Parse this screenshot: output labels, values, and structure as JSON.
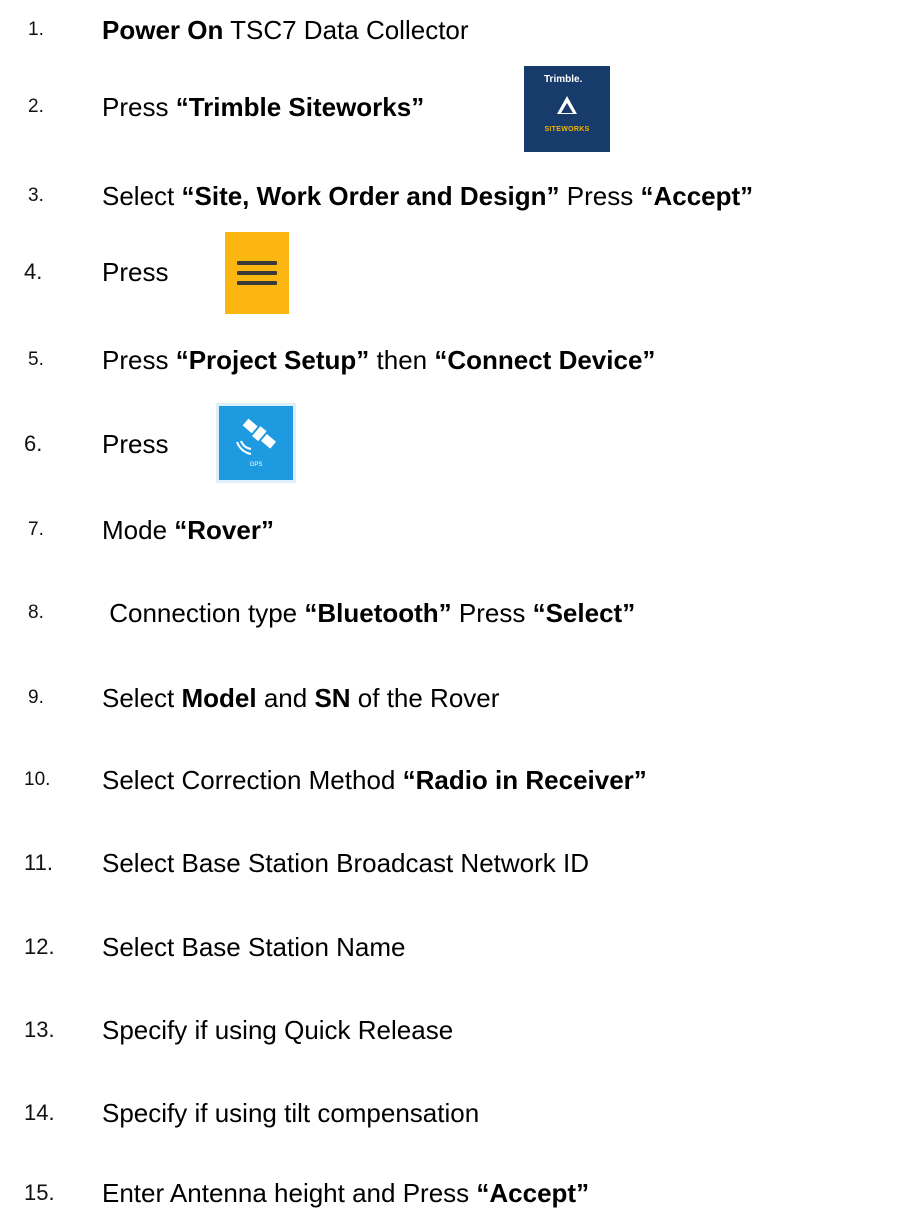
{
  "steps": [
    {
      "num": "1.",
      "parts": [
        {
          "t": "Power On",
          "b": true
        },
        {
          "t": " TSC7 Data Collector",
          "b": false
        }
      ]
    },
    {
      "num": "2.",
      "parts": [
        {
          "t": "Press ",
          "b": false
        },
        {
          "t": "“Trimble Siteworks”",
          "b": true
        }
      ]
    },
    {
      "num": "3.",
      "parts": [
        {
          "t": "Select ",
          "b": false
        },
        {
          "t": "“Site, Work Order and Design”",
          "b": true
        },
        {
          "t": " Press ",
          "b": false
        },
        {
          "t": "“Accept”",
          "b": true
        }
      ]
    },
    {
      "num": "4.",
      "parts": [
        {
          "t": "Press",
          "b": false
        }
      ]
    },
    {
      "num": "5.",
      "parts": [
        {
          "t": "Press ",
          "b": false
        },
        {
          "t": "“Project Setup”",
          "b": true
        },
        {
          "t": " then ",
          "b": false
        },
        {
          "t": "“Connect Device”",
          "b": true
        }
      ]
    },
    {
      "num": "6.",
      "parts": [
        {
          "t": "Press",
          "b": false
        }
      ]
    },
    {
      "num": "7.",
      "parts": [
        {
          "t": "Mode ",
          "b": false
        },
        {
          "t": "“Rover”",
          "b": true
        }
      ]
    },
    {
      "num": "8.",
      "parts": [
        {
          "t": " Connection type ",
          "b": false
        },
        {
          "t": "“Bluetooth”",
          "b": true
        },
        {
          "t": " Press ",
          "b": false
        },
        {
          "t": "“Select”",
          "b": true
        }
      ]
    },
    {
      "num": "9.",
      "parts": [
        {
          "t": "Select ",
          "b": false
        },
        {
          "t": "Model",
          "b": true
        },
        {
          "t": " and ",
          "b": false
        },
        {
          "t": "SN",
          "b": true
        },
        {
          "t": " of the Rover",
          "b": false
        }
      ]
    },
    {
      "num": "10.",
      "parts": [
        {
          "t": "Select Correction Method ",
          "b": false
        },
        {
          "t": "“Radio in Receiver”",
          "b": true
        }
      ]
    },
    {
      "num": "11.",
      "parts": [
        {
          "t": "Select Base Station Broadcast Network ID",
          "b": false
        }
      ]
    },
    {
      "num": "12.",
      "parts": [
        {
          "t": "Select Base Station Name",
          "b": false
        }
      ]
    },
    {
      "num": "13.",
      "parts": [
        {
          "t": "Specify if using Quick Release",
          "b": false
        }
      ]
    },
    {
      "num": "14.",
      "parts": [
        {
          "t": "Specify if using tilt compensation",
          "b": false
        }
      ]
    },
    {
      "num": "15.",
      "parts": [
        {
          "t": "Enter Antenna height and Press ",
          "b": false
        },
        {
          "t": "“Accept”",
          "b": true
        }
      ]
    }
  ],
  "icons": {
    "trimble_siteworks": {
      "name": "trimble-siteworks-app-icon",
      "brand": "Trimble.",
      "caption": "SITEWORKS",
      "bg": "#173b6a",
      "accent": "#f5b400"
    },
    "menu": {
      "name": "hamburger-menu-icon",
      "bg": "#fbb710"
    },
    "gps": {
      "name": "gps-satellite-icon",
      "caption": "GPS",
      "bg": "#1e9be0"
    }
  }
}
